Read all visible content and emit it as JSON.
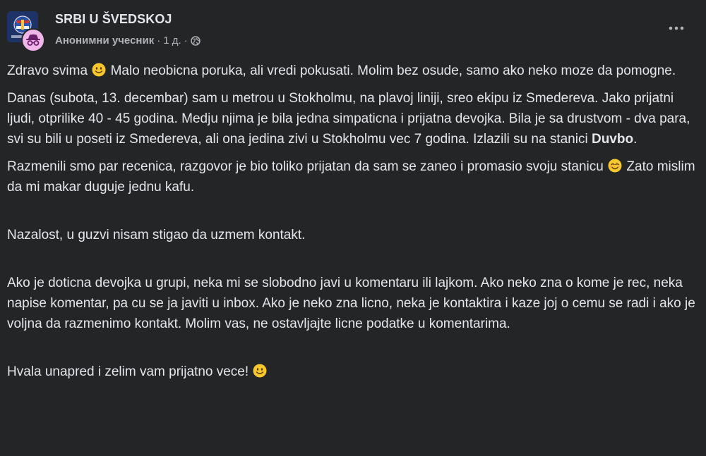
{
  "post": {
    "group_name": "SRBI U ŠVEDSKOJ",
    "author": "Анонимни учесник",
    "separator": "·",
    "time": "1 д.",
    "menu_icon": "more-horizontal-icon",
    "privacy_icon": "globe-icon",
    "paragraphs": {
      "p1": {
        "a": "Zdravo svima",
        "emoji": "slightly-smiling-face",
        "b": "Malo neobicna poruka, ali vredi pokusati. Molim bez osude, samo ako neko moze da pomogne."
      },
      "p2": {
        "a": "Danas (subota, 13. decembar) sam u metrou u Stokholmu, na plavoj liniji, sreo ekipu iz Smedereva. Jako prijatni ljudi, otprilike 40 - 45 godina. Medju njima je bila jedna simpaticna i prijatna devojka. Bila je sa drustvom - dva para, svi su bili u poseti iz Smedereva, ali ona jedina zivi u Stokholmu vec 7 godina. Izlazili su na stanici",
        "bold": "Duvbo",
        "end": "."
      },
      "p3": {
        "a": "Razmenili smo par recenica, razgovor je bio toliko prijatan da sam se zaneo i promasio svoju stanicu",
        "emoji": "smiling-face-with-smiling-eyes",
        "b": "Zato mislim da mi makar duguje jednu kafu."
      },
      "p4": "Nazalost, u guzvi nisam stigao da uzmem kontakt.",
      "p5": "Ako je doticna devojka u grupi, neka mi se slobodno javi u komentaru ili lajkom. Ako neko zna o kome je rec, neka napise komentar, pa cu se ja javiti u inbox. Ako je neko zna licno, neka je kontaktira i kaze joj o cemu se radi i ako je voljna da razmenimo kontakt. Molim vas, ne ostavljajte licne podatke u komentarima.",
      "p6": {
        "a": "Hvala unapred i zelim vam prijatno vece!",
        "emoji": "slightly-smiling-face"
      }
    }
  },
  "colors": {
    "background": "#242526",
    "text_primary": "#e4e6eb",
    "text_secondary": "#b0b3b8",
    "anon_avatar": "#f0b6ea",
    "emoji_yellow": "#f7c72e"
  }
}
